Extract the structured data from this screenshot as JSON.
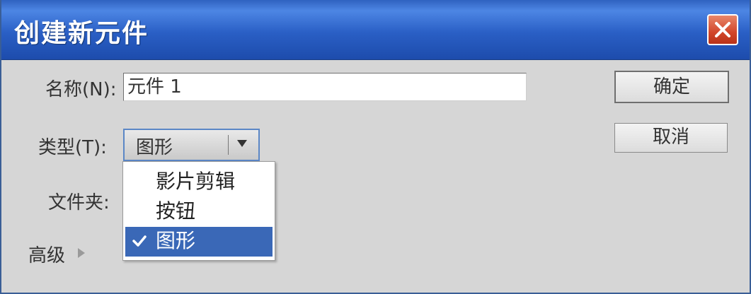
{
  "window": {
    "title": "创建新元件",
    "close_icon": "close-x-icon"
  },
  "form": {
    "name_label": "名称(N):",
    "name_value": "元件 1",
    "type_label": "类型(T):",
    "type_value": "图形",
    "folder_label": "文件夹:",
    "advanced_label": "高级"
  },
  "dropdown": {
    "options": [
      {
        "label": "影片剪辑",
        "selected": false
      },
      {
        "label": "按钮",
        "selected": false
      },
      {
        "label": "图形",
        "selected": true
      }
    ]
  },
  "buttons": {
    "ok_label": "确定",
    "cancel_label": "取消"
  },
  "colors": {
    "titlebar": "#2a5fc5",
    "selection": "#3a68b7",
    "close_button": "#d2462a"
  }
}
